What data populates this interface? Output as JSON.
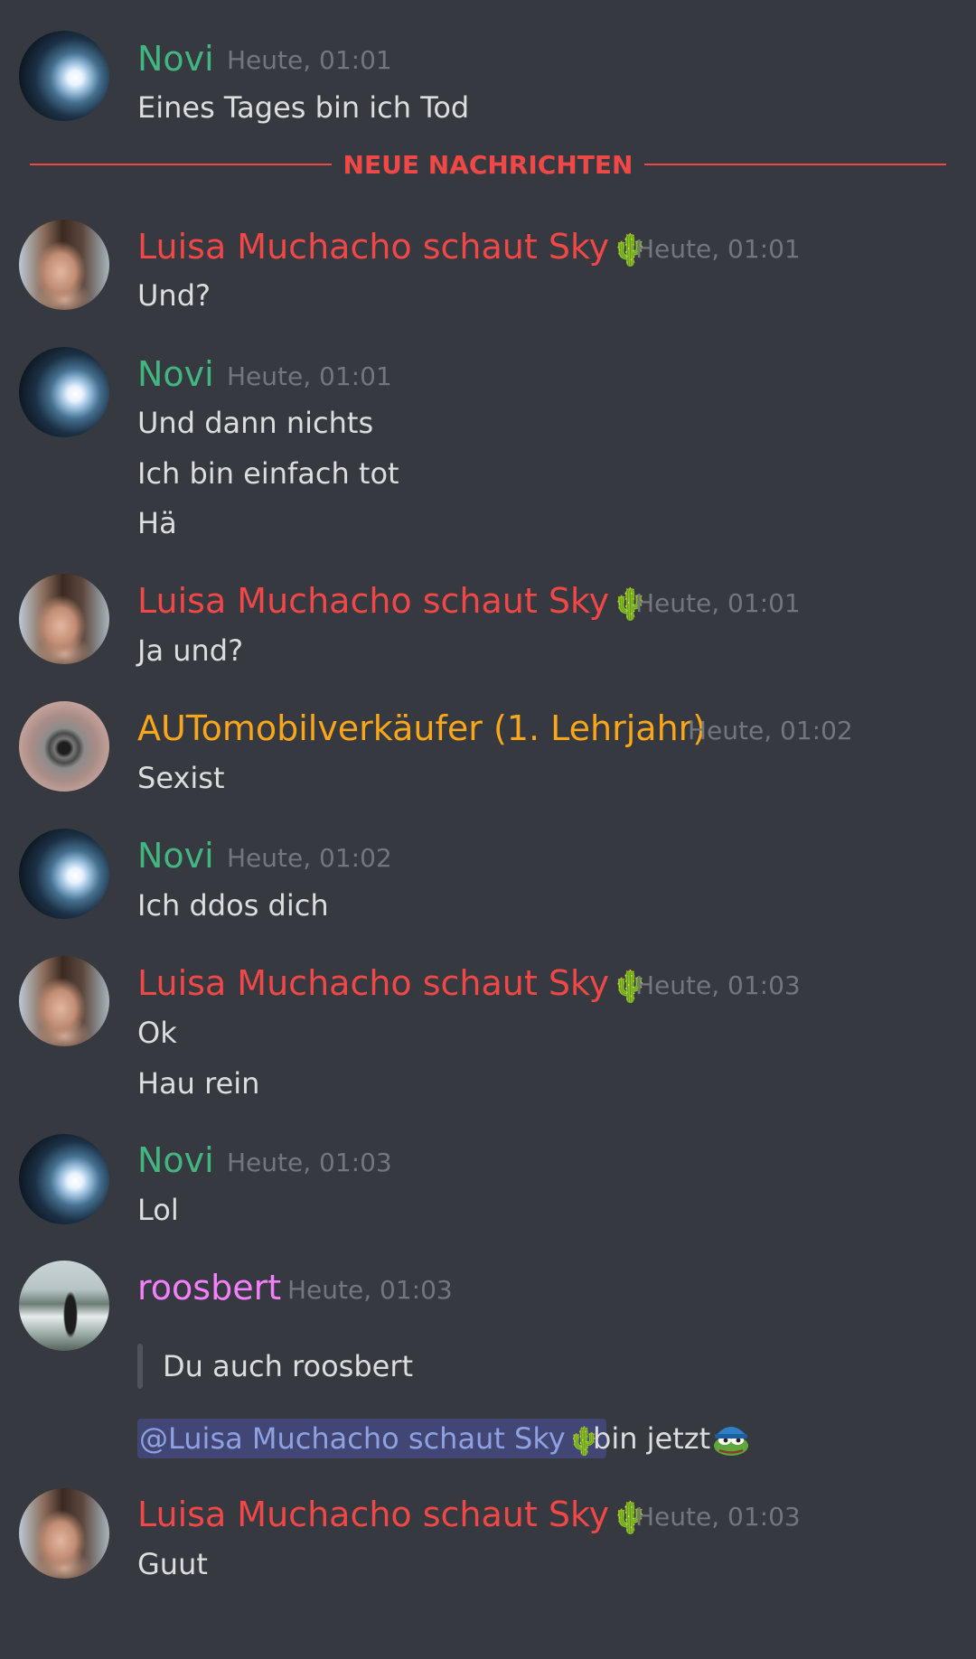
{
  "divider": {
    "label": "NEUE NACHRICHTEN",
    "color": "#f04747"
  },
  "messages": [
    {
      "author": "Novi",
      "time": "Heute, 01:01",
      "lines": [
        "Eines Tages bin ich Tod"
      ]
    },
    {
      "author": "Luisa Muchacho schaut Sky",
      "author_emoji": "🌵",
      "time": "Heute, 01:01",
      "lines": [
        "Und?"
      ]
    },
    {
      "author": "Novi",
      "time": "Heute, 01:01",
      "lines": [
        "Und dann nichts",
        "Ich bin einfach tot",
        "Hä"
      ]
    },
    {
      "author": "Luisa Muchacho schaut Sky",
      "author_emoji": "🌵",
      "time": "Heute, 01:01",
      "lines": [
        "Ja und?"
      ]
    },
    {
      "author": "AUTomobilverkäufer (1. Lehrjahr)",
      "time": "Heute, 01:02",
      "lines": [
        "Sexist"
      ]
    },
    {
      "author": "Novi",
      "time": "Heute, 01:02",
      "lines": [
        "Ich ddos dich"
      ]
    },
    {
      "author": "Luisa Muchacho schaut Sky",
      "author_emoji": "🌵",
      "time": "Heute, 01:03",
      "lines": [
        "Ok",
        "Hau rein"
      ]
    },
    {
      "author": "Novi",
      "time": "Heute, 01:03",
      "lines": [
        "Lol"
      ]
    },
    {
      "author": "roosbert",
      "time": "Heute, 01:03",
      "quote": "Du auch roosbert",
      "mention": "@Luisa Muchacho schaut Sky",
      "mention_emoji": "🌵",
      "after_mention": "bin jetzt",
      "inline_emoji": "pepe-emoji"
    },
    {
      "author": "Luisa Muchacho schaut Sky",
      "author_emoji": "🌵",
      "time": "Heute, 01:03",
      "lines": [
        "Guut"
      ]
    }
  ],
  "colors": {
    "background": "#36393f",
    "novi": "#43b581",
    "luisa": "#f04747",
    "automobil": "#faa61a",
    "roosbert": "#f47fff",
    "mention_text": "#8ea1e1",
    "mention_bg": "#414675",
    "timestamp": "#72767d",
    "message_text": "#dcddde"
  }
}
